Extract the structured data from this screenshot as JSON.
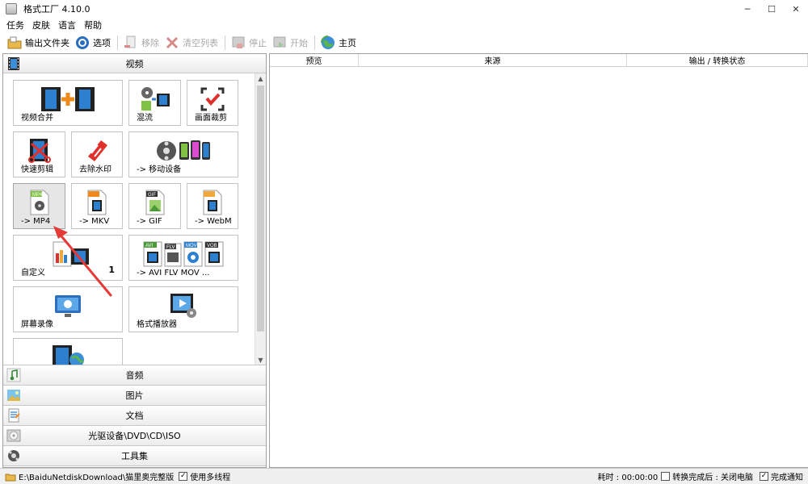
{
  "window": {
    "title": "格式工厂 4.10.0",
    "minimize": "─",
    "maximize": "☐",
    "close": "✕"
  },
  "menu": [
    "任务",
    "皮肤",
    "语言",
    "帮助"
  ],
  "toolbar": {
    "output_folder": "输出文件夹",
    "options": "选项",
    "remove": "移除",
    "clear_list": "清空列表",
    "stop": "停止",
    "start": "开始",
    "home": "主页"
  },
  "left": {
    "video_header": "视频",
    "tiles": [
      {
        "label": "视频合并",
        "badge": ""
      },
      {
        "label": "混流",
        "badge": ""
      },
      {
        "label": "画面裁剪",
        "badge": ""
      },
      {
        "label": "快速剪辑",
        "badge": ""
      },
      {
        "label": "去除水印",
        "badge": ""
      },
      {
        "label": "-> 移动设备",
        "badge": ""
      },
      {
        "label": "-> MP4",
        "badge": ""
      },
      {
        "label": "-> MKV",
        "badge": ""
      },
      {
        "label": "-> GIF",
        "badge": ""
      },
      {
        "label": "-> WebM",
        "badge": ""
      },
      {
        "label": "自定义",
        "badge": "1"
      },
      {
        "label": "-> AVI FLV MOV ...",
        "badge": ""
      },
      {
        "label": "屏幕录像",
        "badge": ""
      },
      {
        "label": "格式播放器",
        "badge": ""
      },
      {
        "label": "",
        "badge": ""
      }
    ],
    "format_tags": {
      "mp4": "MP4",
      "gif": "GIF",
      "avi": "AVI",
      "flv": "FLV",
      "mov": "MOV",
      "vob": "VOB"
    },
    "categories": [
      "音频",
      "图片",
      "文档",
      "光驱设备\\DVD\\CD\\ISO",
      "工具集"
    ]
  },
  "table": {
    "columns": [
      "预览",
      "来源",
      "输出 / 转换状态"
    ]
  },
  "status": {
    "path": "E:\\BaiduNetdiskDownload\\猫里奥完整版",
    "multithread_label": "使用多线程",
    "multithread_checked": "✓",
    "elapsed": "耗时 : 00:00:00",
    "after_convert": "转换完成后 : 关闭电脑",
    "after_convert_checked": "",
    "notify_label": "完成通知",
    "notify_checked": "✓"
  },
  "colors": {
    "accent_red": "#e0302c",
    "film_blue": "#1f6fb8",
    "annotation_arrow": "#e53935"
  }
}
